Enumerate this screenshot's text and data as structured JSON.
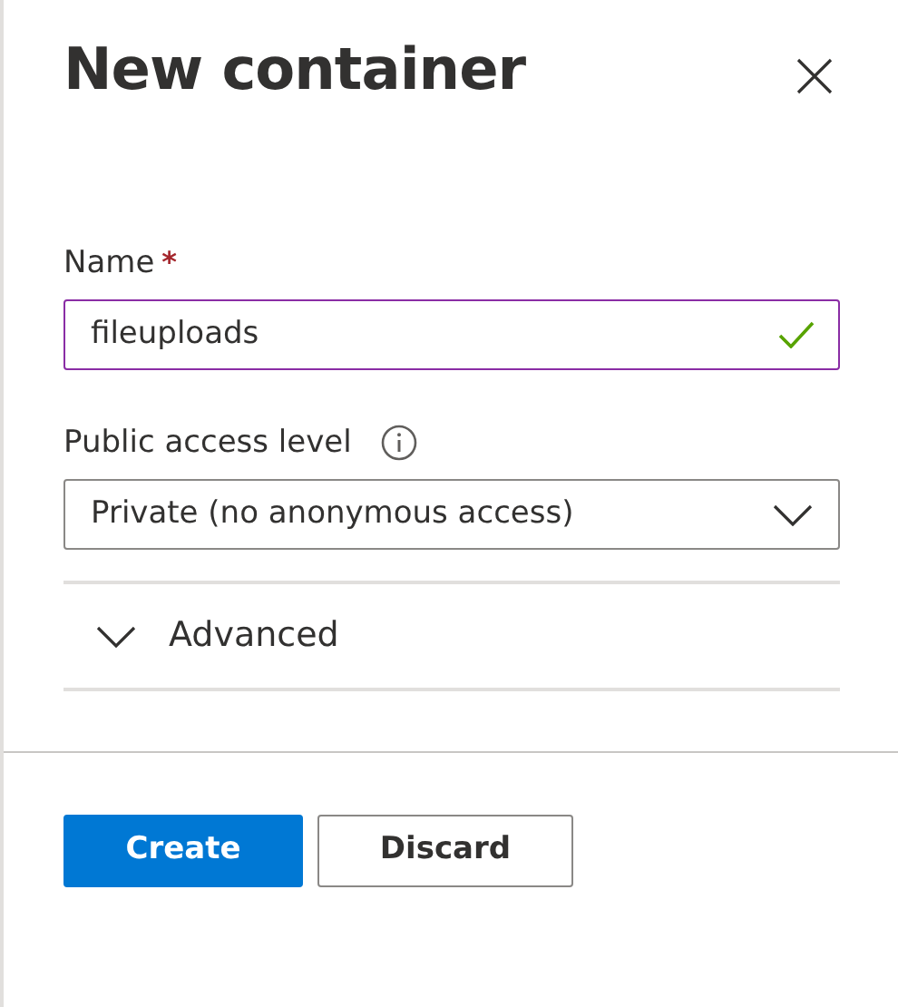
{
  "panel": {
    "title": "New container"
  },
  "name_field": {
    "label": "Name",
    "required": true,
    "required_mark": "*",
    "value": "fileuploads",
    "valid": true
  },
  "access_field": {
    "label": "Public access level",
    "value": "Private (no anonymous access)"
  },
  "advanced": {
    "label": "Advanced",
    "expanded": false
  },
  "buttons": [
    {
      "label": "Create",
      "kind": "primary"
    },
    {
      "label": "Discard",
      "kind": "secondary"
    }
  ]
}
